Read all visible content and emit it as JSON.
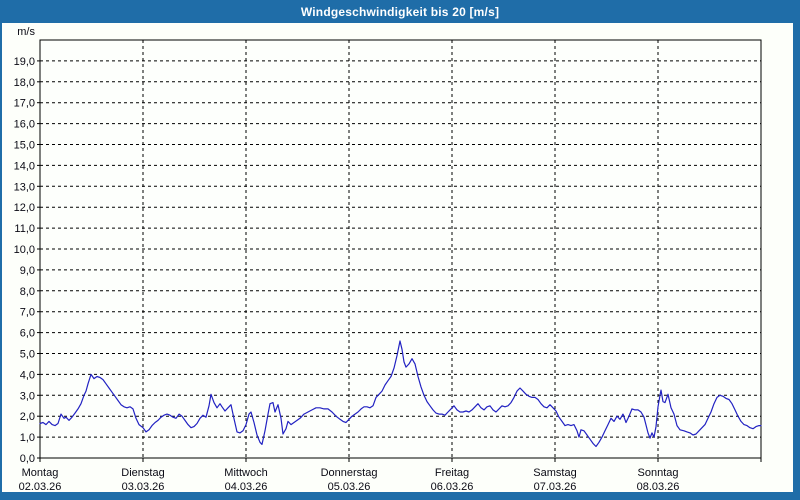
{
  "window": {
    "title": "Windgeschwindigkeit bis 20 [m/s]",
    "accent_color": "#1f6da8",
    "content_background": "#fdfffa"
  },
  "chart_data": {
    "type": "line",
    "title": "Windgeschwindigkeit bis 20 [m/s]",
    "grid": "dashed",
    "legend": "none",
    "line_color": "#2222c2",
    "y_axis": {
      "unit_label": "m/s",
      "min": 0,
      "max": 20,
      "tick_step": 1,
      "tick_labels": [
        "0,0",
        "1,0",
        "2,0",
        "3,0",
        "4,0",
        "5,0",
        "6,0",
        "7,0",
        "8,0",
        "9,0",
        "10,0",
        "11,0",
        "12,0",
        "13,0",
        "14,0",
        "15,0",
        "16,0",
        "17,0",
        "18,0",
        "19,0"
      ]
    },
    "x_axis": {
      "unit": "days",
      "days": [
        {
          "name": "Montag",
          "date": "02.03.26"
        },
        {
          "name": "Dienstag",
          "date": "03.03.26"
        },
        {
          "name": "Mittwoch",
          "date": "04.03.26"
        },
        {
          "name": "Donnerstag",
          "date": "05.03.26"
        },
        {
          "name": "Freitag",
          "date": "06.03.26"
        },
        {
          "name": "Samstag",
          "date": "07.03.26"
        },
        {
          "name": "Sonntag",
          "date": "08.03.26"
        }
      ]
    },
    "series": [
      {
        "name": "Windgeschwindigkeit",
        "points": [
          [
            0.0,
            1.65
          ],
          [
            0.029,
            1.7
          ],
          [
            0.058,
            1.6
          ],
          [
            0.087,
            1.75
          ],
          [
            0.117,
            1.6
          ],
          [
            0.146,
            1.55
          ],
          [
            0.175,
            1.65
          ],
          [
            0.204,
            2.1
          ],
          [
            0.233,
            1.9
          ],
          [
            0.252,
            1.95
          ],
          [
            0.282,
            1.8
          ],
          [
            0.311,
            1.95
          ],
          [
            0.34,
            2.15
          ],
          [
            0.369,
            2.35
          ],
          [
            0.398,
            2.6
          ],
          [
            0.427,
            3.0
          ],
          [
            0.447,
            3.2
          ],
          [
            0.466,
            3.55
          ],
          [
            0.495,
            4.0
          ],
          [
            0.524,
            3.8
          ],
          [
            0.553,
            3.9
          ],
          [
            0.583,
            3.85
          ],
          [
            0.612,
            3.75
          ],
          [
            0.641,
            3.55
          ],
          [
            0.67,
            3.35
          ],
          [
            0.699,
            3.15
          ],
          [
            0.728,
            2.95
          ],
          [
            0.757,
            2.75
          ],
          [
            0.786,
            2.55
          ],
          [
            0.816,
            2.45
          ],
          [
            0.845,
            2.4
          ],
          [
            0.874,
            2.45
          ],
          [
            0.903,
            2.35
          ],
          [
            0.932,
            1.9
          ],
          [
            0.961,
            1.6
          ],
          [
            1.0,
            1.45
          ],
          [
            1.029,
            1.25
          ],
          [
            1.058,
            1.35
          ],
          [
            1.087,
            1.55
          ],
          [
            1.117,
            1.7
          ],
          [
            1.146,
            1.8
          ],
          [
            1.175,
            1.95
          ],
          [
            1.204,
            2.05
          ],
          [
            1.233,
            2.1
          ],
          [
            1.262,
            2.05
          ],
          [
            1.291,
            1.95
          ],
          [
            1.32,
            1.9
          ],
          [
            1.35,
            2.1
          ],
          [
            1.379,
            2.0
          ],
          [
            1.408,
            1.8
          ],
          [
            1.437,
            1.6
          ],
          [
            1.466,
            1.45
          ],
          [
            1.495,
            1.5
          ],
          [
            1.524,
            1.65
          ],
          [
            1.553,
            1.9
          ],
          [
            1.583,
            2.05
          ],
          [
            1.612,
            1.95
          ],
          [
            1.641,
            2.5
          ],
          [
            1.66,
            3.05
          ],
          [
            1.689,
            2.65
          ],
          [
            1.718,
            2.4
          ],
          [
            1.748,
            2.6
          ],
          [
            1.767,
            2.45
          ],
          [
            1.796,
            2.25
          ],
          [
            1.825,
            2.4
          ],
          [
            1.854,
            2.55
          ],
          [
            1.883,
            1.9
          ],
          [
            1.913,
            1.25
          ],
          [
            1.942,
            1.2
          ],
          [
            1.971,
            1.3
          ],
          [
            2.0,
            1.6
          ],
          [
            2.029,
            2.1
          ],
          [
            2.049,
            2.2
          ],
          [
            2.078,
            1.7
          ],
          [
            2.107,
            1.1
          ],
          [
            2.136,
            0.75
          ],
          [
            2.155,
            0.65
          ],
          [
            2.184,
            1.3
          ],
          [
            2.214,
            2.1
          ],
          [
            2.233,
            2.6
          ],
          [
            2.262,
            2.65
          ],
          [
            2.282,
            2.2
          ],
          [
            2.311,
            2.55
          ],
          [
            2.34,
            1.9
          ],
          [
            2.359,
            1.15
          ],
          [
            2.388,
            1.4
          ],
          [
            2.408,
            1.75
          ],
          [
            2.437,
            1.6
          ],
          [
            2.466,
            1.7
          ],
          [
            2.495,
            1.8
          ],
          [
            2.524,
            1.9
          ],
          [
            2.563,
            2.1
          ],
          [
            2.602,
            2.2
          ],
          [
            2.641,
            2.3
          ],
          [
            2.68,
            2.4
          ],
          [
            2.718,
            2.4
          ],
          [
            2.757,
            2.35
          ],
          [
            2.796,
            2.35
          ],
          [
            2.835,
            2.2
          ],
          [
            2.874,
            2.0
          ],
          [
            2.913,
            1.85
          ],
          [
            2.942,
            1.75
          ],
          [
            2.971,
            1.7
          ],
          [
            3.0,
            1.85
          ],
          [
            3.029,
            2.0
          ],
          [
            3.058,
            2.1
          ],
          [
            3.087,
            2.2
          ],
          [
            3.117,
            2.35
          ],
          [
            3.146,
            2.45
          ],
          [
            3.175,
            2.45
          ],
          [
            3.204,
            2.4
          ],
          [
            3.233,
            2.5
          ],
          [
            3.262,
            2.9
          ],
          [
            3.291,
            3.05
          ],
          [
            3.32,
            3.2
          ],
          [
            3.35,
            3.5
          ],
          [
            3.379,
            3.7
          ],
          [
            3.408,
            3.9
          ],
          [
            3.437,
            4.3
          ],
          [
            3.466,
            4.9
          ],
          [
            3.495,
            5.6
          ],
          [
            3.515,
            5.2
          ],
          [
            3.534,
            4.6
          ],
          [
            3.553,
            4.35
          ],
          [
            3.583,
            4.5
          ],
          [
            3.612,
            4.75
          ],
          [
            3.641,
            4.5
          ],
          [
            3.67,
            3.9
          ],
          [
            3.699,
            3.4
          ],
          [
            3.728,
            3.0
          ],
          [
            3.757,
            2.7
          ],
          [
            3.786,
            2.5
          ],
          [
            3.816,
            2.3
          ],
          [
            3.845,
            2.15
          ],
          [
            3.874,
            2.1
          ],
          [
            3.903,
            2.1
          ],
          [
            3.932,
            2.05
          ],
          [
            3.961,
            2.2
          ],
          [
            3.99,
            2.35
          ],
          [
            4.019,
            2.5
          ],
          [
            4.049,
            2.3
          ],
          [
            4.078,
            2.2
          ],
          [
            4.107,
            2.2
          ],
          [
            4.136,
            2.25
          ],
          [
            4.165,
            2.2
          ],
          [
            4.194,
            2.3
          ],
          [
            4.223,
            2.45
          ],
          [
            4.252,
            2.6
          ],
          [
            4.282,
            2.4
          ],
          [
            4.311,
            2.3
          ],
          [
            4.34,
            2.45
          ],
          [
            4.369,
            2.5
          ],
          [
            4.398,
            2.3
          ],
          [
            4.427,
            2.2
          ],
          [
            4.456,
            2.35
          ],
          [
            4.485,
            2.5
          ],
          [
            4.515,
            2.45
          ],
          [
            4.544,
            2.5
          ],
          [
            4.573,
            2.65
          ],
          [
            4.602,
            2.9
          ],
          [
            4.631,
            3.2
          ],
          [
            4.66,
            3.35
          ],
          [
            4.689,
            3.2
          ],
          [
            4.718,
            3.05
          ],
          [
            4.748,
            2.95
          ],
          [
            4.777,
            2.9
          ],
          [
            4.806,
            2.9
          ],
          [
            4.835,
            2.8
          ],
          [
            4.864,
            2.6
          ],
          [
            4.893,
            2.45
          ],
          [
            4.922,
            2.4
          ],
          [
            4.951,
            2.55
          ],
          [
            4.981,
            2.4
          ],
          [
            5.01,
            2.25
          ],
          [
            5.039,
            1.95
          ],
          [
            5.068,
            1.75
          ],
          [
            5.097,
            1.55
          ],
          [
            5.126,
            1.6
          ],
          [
            5.155,
            1.55
          ],
          [
            5.184,
            1.6
          ],
          [
            5.214,
            1.3
          ],
          [
            5.233,
            1.0
          ],
          [
            5.252,
            1.35
          ],
          [
            5.282,
            1.3
          ],
          [
            5.311,
            1.1
          ],
          [
            5.34,
            0.9
          ],
          [
            5.369,
            0.7
          ],
          [
            5.398,
            0.55
          ],
          [
            5.427,
            0.75
          ],
          [
            5.456,
            1.0
          ],
          [
            5.485,
            1.3
          ],
          [
            5.515,
            1.6
          ],
          [
            5.544,
            1.9
          ],
          [
            5.573,
            1.75
          ],
          [
            5.602,
            2.0
          ],
          [
            5.631,
            1.85
          ],
          [
            5.66,
            2.1
          ],
          [
            5.689,
            1.7
          ],
          [
            5.718,
            2.0
          ],
          [
            5.748,
            2.35
          ],
          [
            5.777,
            2.3
          ],
          [
            5.806,
            2.3
          ],
          [
            5.835,
            2.2
          ],
          [
            5.864,
            1.95
          ],
          [
            5.883,
            1.6
          ],
          [
            5.903,
            1.2
          ],
          [
            5.922,
            0.95
          ],
          [
            5.942,
            1.2
          ],
          [
            5.961,
            1.0
          ],
          [
            5.981,
            1.5
          ],
          [
            6.0,
            2.45
          ],
          [
            6.019,
            3.0
          ],
          [
            6.029,
            3.25
          ],
          [
            6.049,
            2.7
          ],
          [
            6.068,
            2.65
          ],
          [
            6.097,
            3.05
          ],
          [
            6.126,
            2.4
          ],
          [
            6.155,
            2.1
          ],
          [
            6.184,
            1.55
          ],
          [
            6.214,
            1.35
          ],
          [
            6.252,
            1.3
          ],
          [
            6.282,
            1.25
          ],
          [
            6.311,
            1.2
          ],
          [
            6.34,
            1.1
          ],
          [
            6.369,
            1.15
          ],
          [
            6.398,
            1.3
          ],
          [
            6.427,
            1.45
          ],
          [
            6.456,
            1.6
          ],
          [
            6.485,
            1.9
          ],
          [
            6.515,
            2.2
          ],
          [
            6.544,
            2.6
          ],
          [
            6.573,
            2.9
          ],
          [
            6.602,
            3.0
          ],
          [
            6.631,
            2.95
          ],
          [
            6.66,
            2.85
          ],
          [
            6.689,
            2.8
          ],
          [
            6.718,
            2.6
          ],
          [
            6.748,
            2.3
          ],
          [
            6.777,
            2.0
          ],
          [
            6.806,
            1.75
          ],
          [
            6.835,
            1.6
          ],
          [
            6.864,
            1.55
          ],
          [
            6.893,
            1.45
          ],
          [
            6.922,
            1.4
          ],
          [
            6.951,
            1.5
          ],
          [
            6.981,
            1.55
          ],
          [
            7.0,
            1.55
          ]
        ]
      }
    ]
  }
}
